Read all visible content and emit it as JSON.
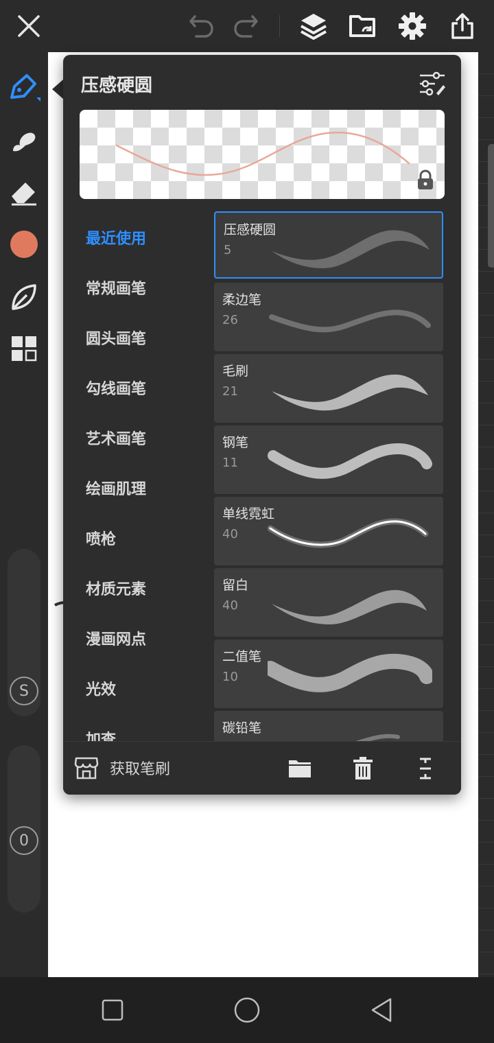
{
  "toolbar": {
    "icons": [
      "close-icon",
      "undo-icon",
      "redo-icon",
      "layers-icon",
      "folder-sync-icon",
      "gear-icon",
      "share-icon"
    ]
  },
  "left_toolbar": {
    "icons": [
      "brush-pen-icon",
      "smudge-icon",
      "eraser-icon",
      "color-swatch",
      "leaf-icon",
      "grid-icon"
    ],
    "current_color": "#e07a5f",
    "slider_size_label": "S",
    "slider_opacity_label": "0"
  },
  "brush_panel": {
    "title": "压感硬圆",
    "categories": [
      {
        "label": "最近使用",
        "active": true
      },
      {
        "label": "常规画笔"
      },
      {
        "label": "圆头画笔"
      },
      {
        "label": "勾线画笔"
      },
      {
        "label": "艺术画笔"
      },
      {
        "label": "绘画肌理"
      },
      {
        "label": "喷枪"
      },
      {
        "label": "材质元素"
      },
      {
        "label": "漫画网点"
      },
      {
        "label": "光效"
      },
      {
        "label": "加查"
      }
    ],
    "brushes": [
      {
        "name": "压感硬圆",
        "size": "5",
        "selected": true
      },
      {
        "name": "柔边笔",
        "size": "26"
      },
      {
        "name": "毛刷",
        "size": "21"
      },
      {
        "name": "钢笔",
        "size": "11"
      },
      {
        "name": "单线霓虹",
        "size": "40"
      },
      {
        "name": "留白",
        "size": "40"
      },
      {
        "name": "二值笔",
        "size": "10"
      },
      {
        "name": "碳铅笔",
        "size": ""
      }
    ],
    "footer": {
      "get_brushes_label": "获取笔刷"
    }
  },
  "colors": {
    "accent": "#2e8fff",
    "panel_bg": "#2d2d2d",
    "preview_stroke": "#e8a898"
  },
  "nav": {
    "icons": [
      "recent-apps-icon",
      "home-icon",
      "back-icon"
    ]
  }
}
